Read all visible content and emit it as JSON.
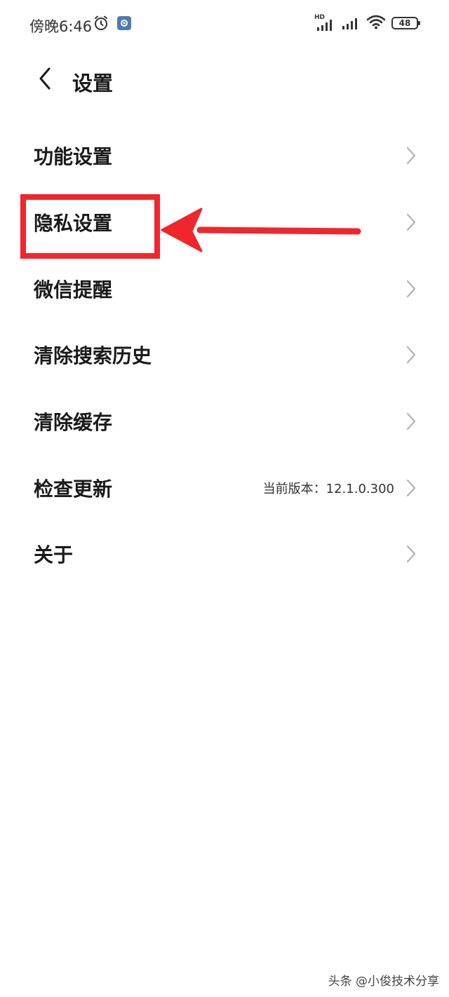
{
  "status_bar": {
    "time": "傍晚6:46",
    "network_label": "HD",
    "battery": "48"
  },
  "header": {
    "title": "设置"
  },
  "settings": {
    "items": [
      {
        "label": "功能设置",
        "value": ""
      },
      {
        "label": "隐私设置",
        "value": ""
      },
      {
        "label": "微信提醒",
        "value": ""
      },
      {
        "label": "清除搜索历史",
        "value": ""
      },
      {
        "label": "清除缓存",
        "value": ""
      },
      {
        "label": "检查更新",
        "value": "当前版本：12.1.0.300"
      },
      {
        "label": "关于",
        "value": ""
      }
    ]
  },
  "annotation": {
    "highlighted_item": "隐私设置",
    "color": "#f0262c"
  },
  "watermark": "头条 @小俊技术分享",
  "colors": {
    "background": "#ffffff",
    "text": "#1a1a1a",
    "chevron": "#b3b3b3",
    "annotation": "#f0262c"
  }
}
